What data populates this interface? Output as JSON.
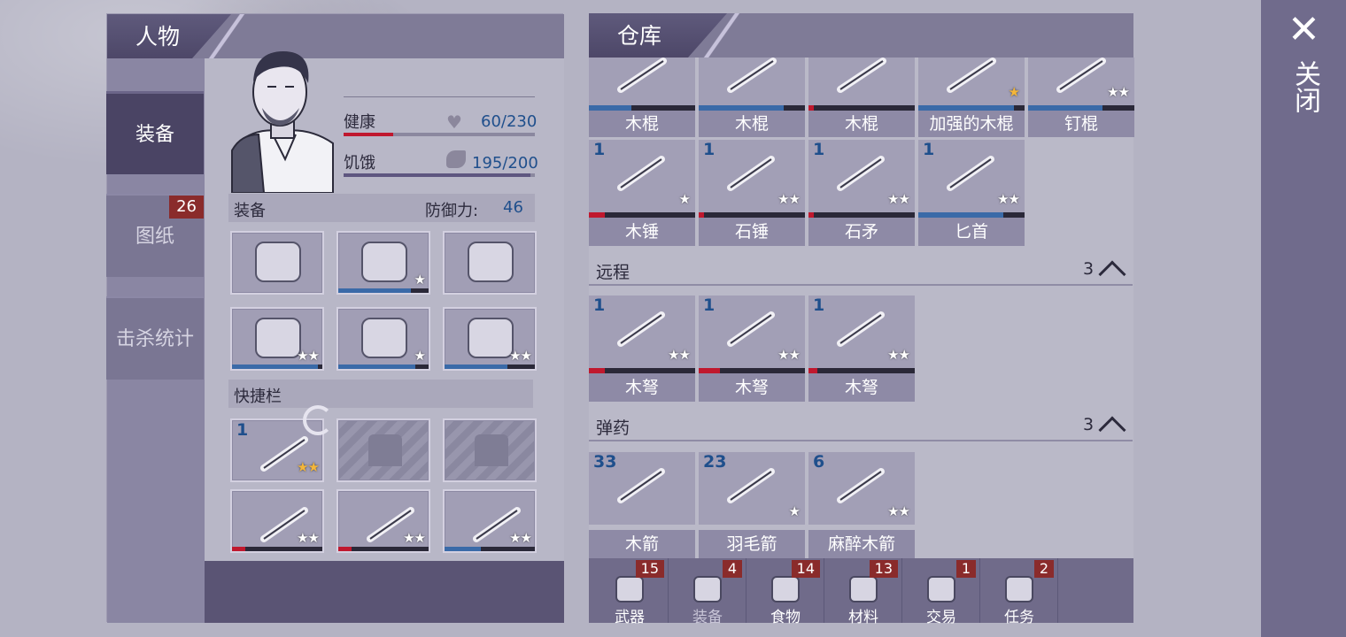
{
  "left_panel": {
    "title": "人物",
    "tabs": [
      {
        "label": "装备",
        "active": true
      },
      {
        "label": "图纸",
        "badge": "26"
      },
      {
        "label": "击杀统计"
      }
    ],
    "stats": {
      "health_label": "健康",
      "health_value": "60/230",
      "health_fraction": 0.261,
      "hunger_label": "饥饿",
      "hunger_value": "195/200",
      "hunger_fraction": 0.975
    },
    "equipment": {
      "title": "装备",
      "defense_label": "防御力:",
      "defense_value": "46",
      "slots": [
        {
          "icon": "beanie-hat-icon",
          "stars": "",
          "bar": null
        },
        {
          "icon": "tshirt-icon",
          "stars": "★",
          "bar": 0.8
        },
        {
          "icon": "jacket-icon",
          "stars": "",
          "bar": null
        },
        {
          "icon": "gloves-icon",
          "stars": "★★",
          "bar": 0.95
        },
        {
          "icon": "shorts-icon",
          "stars": "★",
          "bar": 0.85
        },
        {
          "icon": "sneakers-icon",
          "stars": "★★",
          "bar": 0.7
        }
      ]
    },
    "quickbar": {
      "title": "快捷栏",
      "slots": [
        {
          "icon": "poison-arrow-icon",
          "count": "1",
          "stars": "★★",
          "gold": true
        },
        {
          "icon": "ammo-placeholder-icon",
          "empty": true
        },
        {
          "icon": "ammo-placeholder-icon",
          "empty": true
        },
        {
          "icon": "crossbow-icon",
          "stars": "★★",
          "bar": 0.15,
          "barcolor": "#c0182e"
        },
        {
          "icon": "spear-icon",
          "stars": "★★",
          "bar": 0.15,
          "barcolor": "#c0182e"
        },
        {
          "icon": "stone-hammer-icon",
          "stars": "★★",
          "bar": 0.4,
          "barcolor": "#3a6aa8"
        }
      ]
    }
  },
  "right_panel": {
    "title": "仓库",
    "top_row": [
      {
        "label": "木棍",
        "icon": "wooden-club-icon",
        "stars": "",
        "bar": 0.4,
        "barcolor": "#3a6aa8"
      },
      {
        "label": "木棍",
        "icon": "wooden-club-icon",
        "stars": "",
        "bar": 0.8,
        "barcolor": "#3a6aa8"
      },
      {
        "label": "木棍",
        "icon": "wooden-club-icon",
        "stars": "",
        "bar": 0.05,
        "barcolor": "#c0182e"
      },
      {
        "label": "加强的木棍",
        "icon": "reinforced-club-icon",
        "stars": "★",
        "gold": true,
        "bar": 0.9,
        "barcolor": "#3a6aa8"
      },
      {
        "label": "钉棍",
        "icon": "nail-club-icon",
        "stars": "★★",
        "bar": 0.7,
        "barcolor": "#3a6aa8"
      }
    ],
    "second_row": [
      {
        "label": "木锤",
        "icon": "wooden-hammer-icon",
        "count": "1",
        "stars": "★",
        "bar": 0.15,
        "barcolor": "#c0182e"
      },
      {
        "label": "石锤",
        "icon": "stone-hammer-icon",
        "count": "1",
        "stars": "★★",
        "bar": 0.05,
        "barcolor": "#c0182e"
      },
      {
        "label": "石矛",
        "icon": "stone-spear-icon",
        "count": "1",
        "stars": "★★",
        "bar": 0.05,
        "barcolor": "#c0182e"
      },
      {
        "label": "匕首",
        "icon": "dagger-icon",
        "count": "1",
        "stars": "★★",
        "bar": 0.8,
        "barcolor": "#3a6aa8"
      }
    ],
    "ranged": {
      "title": "远程",
      "count": "3",
      "items": [
        {
          "label": "木弩",
          "icon": "crossbow-icon",
          "count": "1",
          "stars": "★★",
          "bar": 0.15,
          "barcolor": "#c0182e"
        },
        {
          "label": "木弩",
          "icon": "crossbow-icon",
          "count": "1",
          "stars": "★★",
          "bar": 0.2,
          "barcolor": "#c0182e"
        },
        {
          "label": "木弩",
          "icon": "crossbow-icon",
          "count": "1",
          "stars": "★★",
          "bar": 0.08,
          "barcolor": "#c0182e"
        }
      ]
    },
    "ammo": {
      "title": "弹药",
      "count": "3",
      "items": [
        {
          "label": "木箭",
          "icon": "wooden-arrow-icon",
          "count": "33",
          "stars": ""
        },
        {
          "label": "羽毛箭",
          "icon": "feather-arrow-icon",
          "count": "23",
          "stars": "★"
        },
        {
          "label": "麻醉木箭",
          "icon": "tranquilizer-arrow-icon",
          "count": "6",
          "stars": "★★"
        }
      ]
    },
    "bottom_nav": [
      {
        "label": "武器",
        "badge": "15",
        "icon": "axe-icon"
      },
      {
        "label": "装备",
        "badge": "4",
        "icon": "shirt-icon"
      },
      {
        "label": "食物",
        "badge": "14",
        "icon": "meat-icon"
      },
      {
        "label": "材料",
        "badge": "13",
        "icon": "log-icon"
      },
      {
        "label": "交易",
        "badge": "1",
        "icon": "coin-icon"
      },
      {
        "label": "任务",
        "badge": "2",
        "icon": "key-icon"
      }
    ]
  },
  "close": {
    "label": "关闭"
  }
}
